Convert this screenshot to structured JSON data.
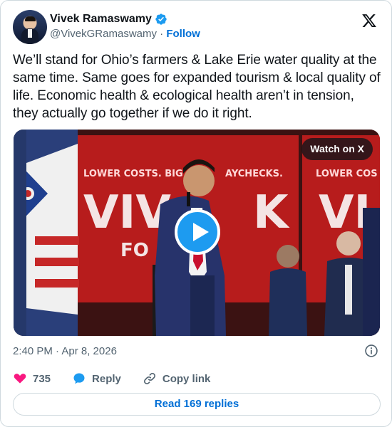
{
  "author": {
    "name": "Vivek Ramaswamy",
    "handle": "@VivekGRamaswamy",
    "separator": "·",
    "follow_label": "Follow",
    "verified": true
  },
  "tweet": {
    "text": "We’ll stand for Ohio’s farmers & Lake Erie water quality at the same time. Same goes for expanded tourism & local quality of life. Economic health & ecological health aren’t in tension, they actually go together if we do it right.",
    "timestamp": "2:40 PM · Apr 8, 2026"
  },
  "media": {
    "watch_label": "Watch on X",
    "banner_tagline": "LOWER COSTS. BIG",
    "banner_tagline_2": "AYCHECKS.",
    "banner_tagline_right": "LOWER COS",
    "banner_logo_left": "VIV",
    "banner_logo_right": "K",
    "banner_subtitle": "FO",
    "banner_logo_far_right": "VI"
  },
  "actions": {
    "likes": "735",
    "reply_label": "Reply",
    "copy_label": "Copy link"
  },
  "read_replies_label": "Read 169 replies",
  "colors": {
    "accent": "#1d9bf0",
    "link": "#006fd6",
    "heart": "#f91880",
    "text": "#0f1419",
    "muted": "#536471",
    "banner_red": "#b71c1c"
  }
}
